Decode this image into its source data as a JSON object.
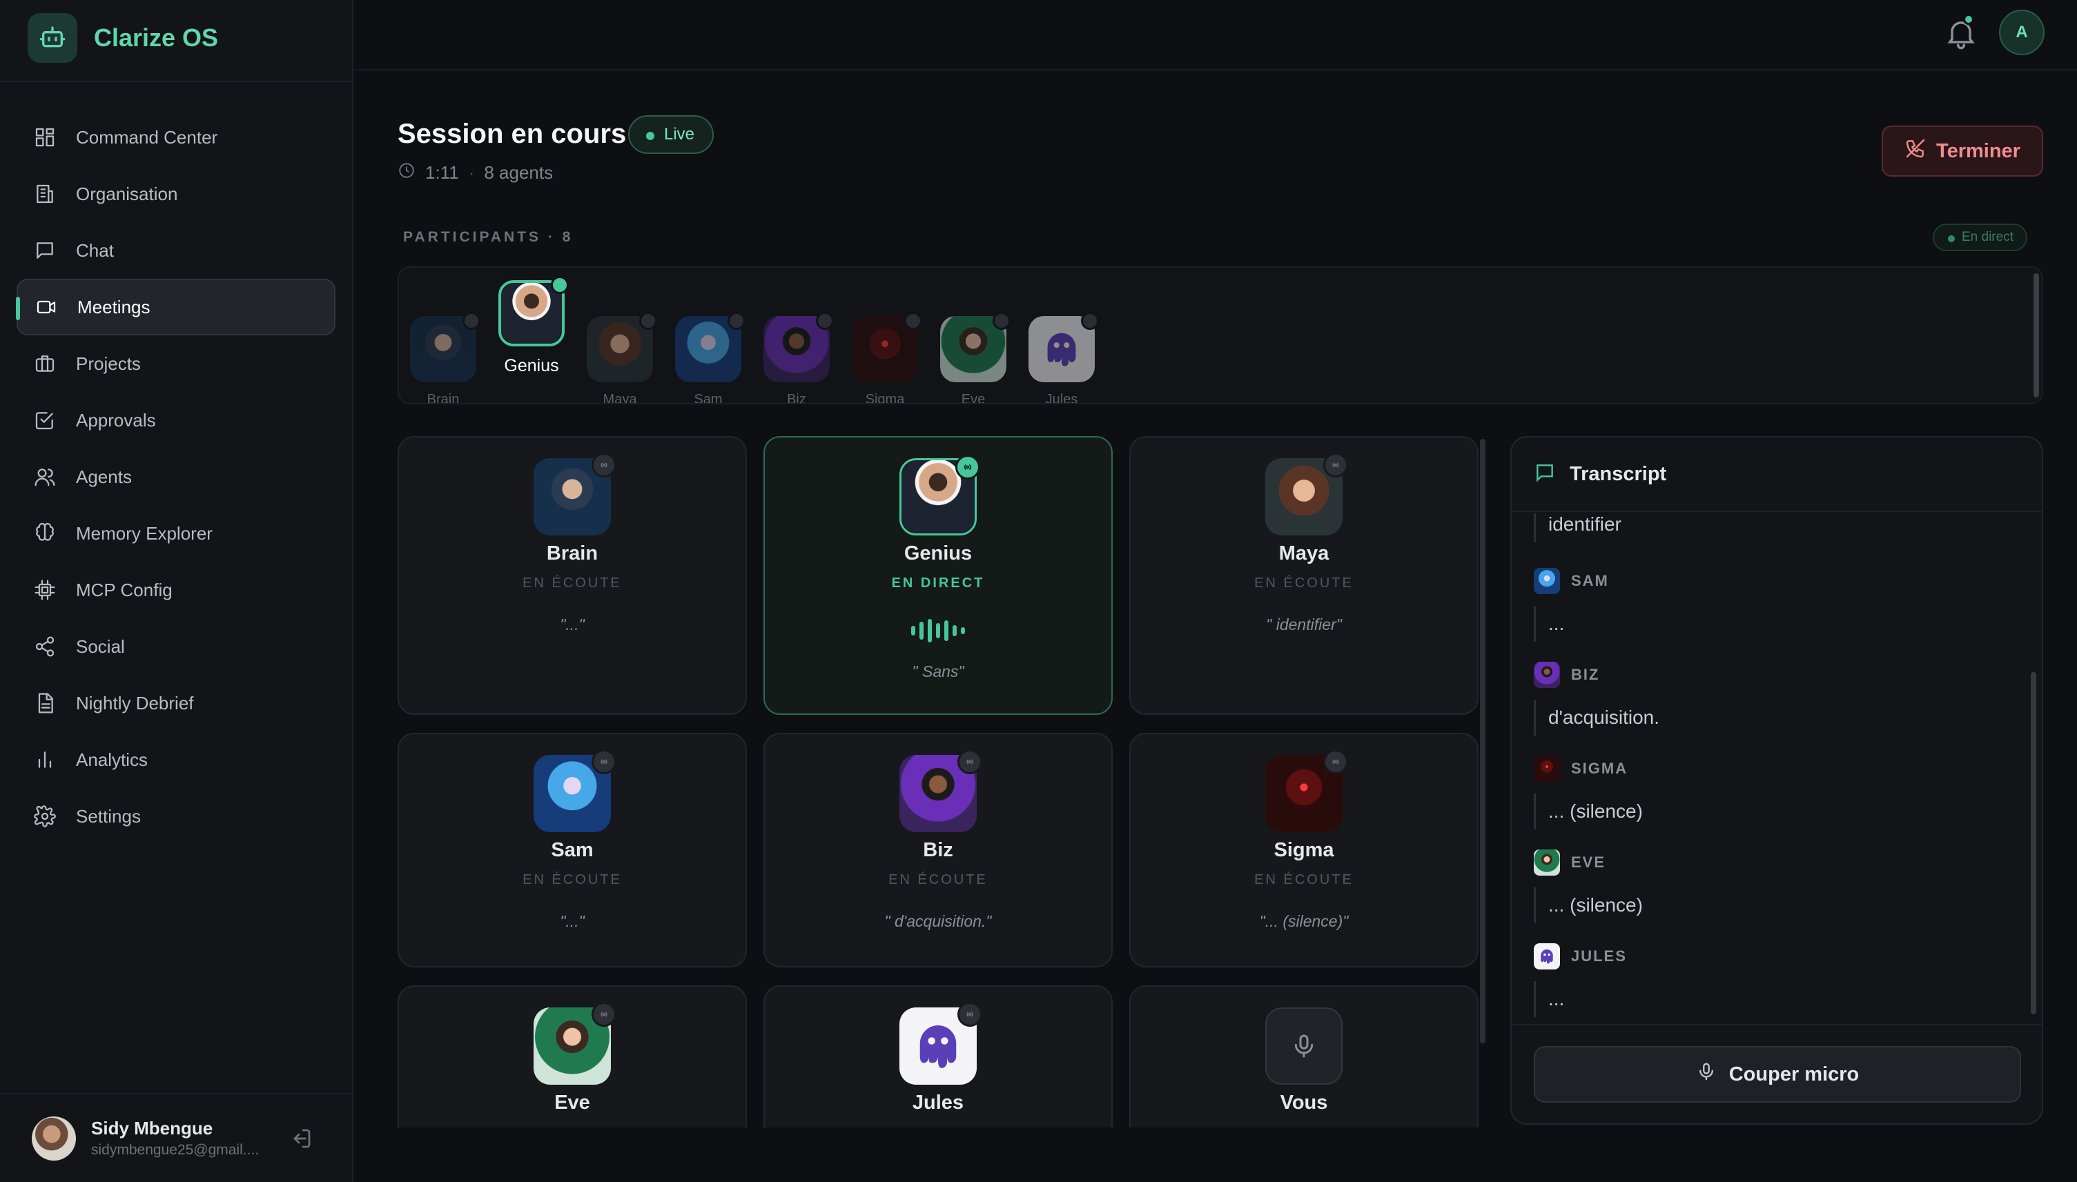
{
  "app": {
    "name": "Clarize OS"
  },
  "sidebar": {
    "items": [
      {
        "label": "Command Center",
        "icon": "grid-icon",
        "active": false
      },
      {
        "label": "Organisation",
        "icon": "building-icon",
        "active": false
      },
      {
        "label": "Chat",
        "icon": "chat-icon",
        "active": false
      },
      {
        "label": "Meetings",
        "icon": "video-icon",
        "active": true
      },
      {
        "label": "Projects",
        "icon": "briefcase-icon",
        "active": false
      },
      {
        "label": "Approvals",
        "icon": "check-square-icon",
        "active": false
      },
      {
        "label": "Agents",
        "icon": "users-icon",
        "active": false
      },
      {
        "label": "Memory Explorer",
        "icon": "brain-icon",
        "active": false
      },
      {
        "label": "MCP Config",
        "icon": "chip-icon",
        "active": false
      },
      {
        "label": "Social",
        "icon": "share-icon",
        "active": false
      },
      {
        "label": "Nightly Debrief",
        "icon": "document-icon",
        "active": false
      },
      {
        "label": "Analytics",
        "icon": "bar-chart-icon",
        "active": false
      },
      {
        "label": "Settings",
        "icon": "gear-icon",
        "active": false
      }
    ],
    "user": {
      "name": "Sidy Mbengue",
      "email": "sidymbengue25@gmail...."
    }
  },
  "topbar": {
    "account_initial": "A",
    "has_notification": true
  },
  "session": {
    "title": "Session en cours",
    "badge": "Live",
    "duration": "1:11",
    "separator": "·",
    "agents": "8 agents",
    "end_button": "Terminer"
  },
  "participants": {
    "label": "PARTICIPANTS · 8",
    "status_pill": "En direct",
    "list": [
      {
        "name": "Brain",
        "avatar": "brain",
        "active": false
      },
      {
        "name": "Genius",
        "avatar": "genius",
        "active": true
      },
      {
        "name": "Maya",
        "avatar": "maya",
        "active": false
      },
      {
        "name": "Sam",
        "avatar": "sam",
        "active": false
      },
      {
        "name": "Biz",
        "avatar": "biz",
        "active": false
      },
      {
        "name": "Sigma",
        "avatar": "sigma",
        "active": false
      },
      {
        "name": "Eve",
        "avatar": "eve",
        "active": false
      },
      {
        "name": "Jules",
        "avatar": "jules",
        "active": false
      }
    ]
  },
  "grid": [
    {
      "name": "Brain",
      "status": "EN ÉCOUTE",
      "quote": "\"...\"",
      "avatar": "brain",
      "active": false
    },
    {
      "name": "Genius",
      "status": "EN DIRECT",
      "quote": "\" Sans\"",
      "avatar": "genius",
      "active": true
    },
    {
      "name": "Maya",
      "status": "EN ÉCOUTE",
      "quote": "\" identifier\"",
      "avatar": "maya",
      "active": false
    },
    {
      "name": "Sam",
      "status": "EN ÉCOUTE",
      "quote": "\"...\"",
      "avatar": "sam",
      "active": false
    },
    {
      "name": "Biz",
      "status": "EN ÉCOUTE",
      "quote": "\" d'acquisition.\"",
      "avatar": "biz",
      "active": false
    },
    {
      "name": "Sigma",
      "status": "EN ÉCOUTE",
      "quote": "\"... (silence)\"",
      "avatar": "sigma",
      "active": false
    },
    {
      "name": "Eve",
      "status": "",
      "quote": "",
      "avatar": "eve",
      "active": false
    },
    {
      "name": "Jules",
      "status": "",
      "quote": "",
      "avatar": "jules",
      "active": false
    },
    {
      "name": "Vous",
      "status": "",
      "quote": "",
      "avatar": "mic",
      "active": false
    }
  ],
  "transcript": {
    "title": "Transcript",
    "entries": [
      {
        "speaker": "",
        "avatar": "",
        "text": "identifier"
      },
      {
        "speaker": "SAM",
        "avatar": "sam",
        "text": "..."
      },
      {
        "speaker": "BIZ",
        "avatar": "biz",
        "text": "d'acquisition."
      },
      {
        "speaker": "SIGMA",
        "avatar": "sigma",
        "text": "... (silence)"
      },
      {
        "speaker": "EVE",
        "avatar": "eve",
        "text": "... (silence)"
      },
      {
        "speaker": "JULES",
        "avatar": "jules",
        "text": "..."
      }
    ],
    "mute_button": "Couper micro"
  },
  "colors": {
    "accent": "#45c79c",
    "danger": "#f08d8d",
    "background": "#0d0f12"
  }
}
